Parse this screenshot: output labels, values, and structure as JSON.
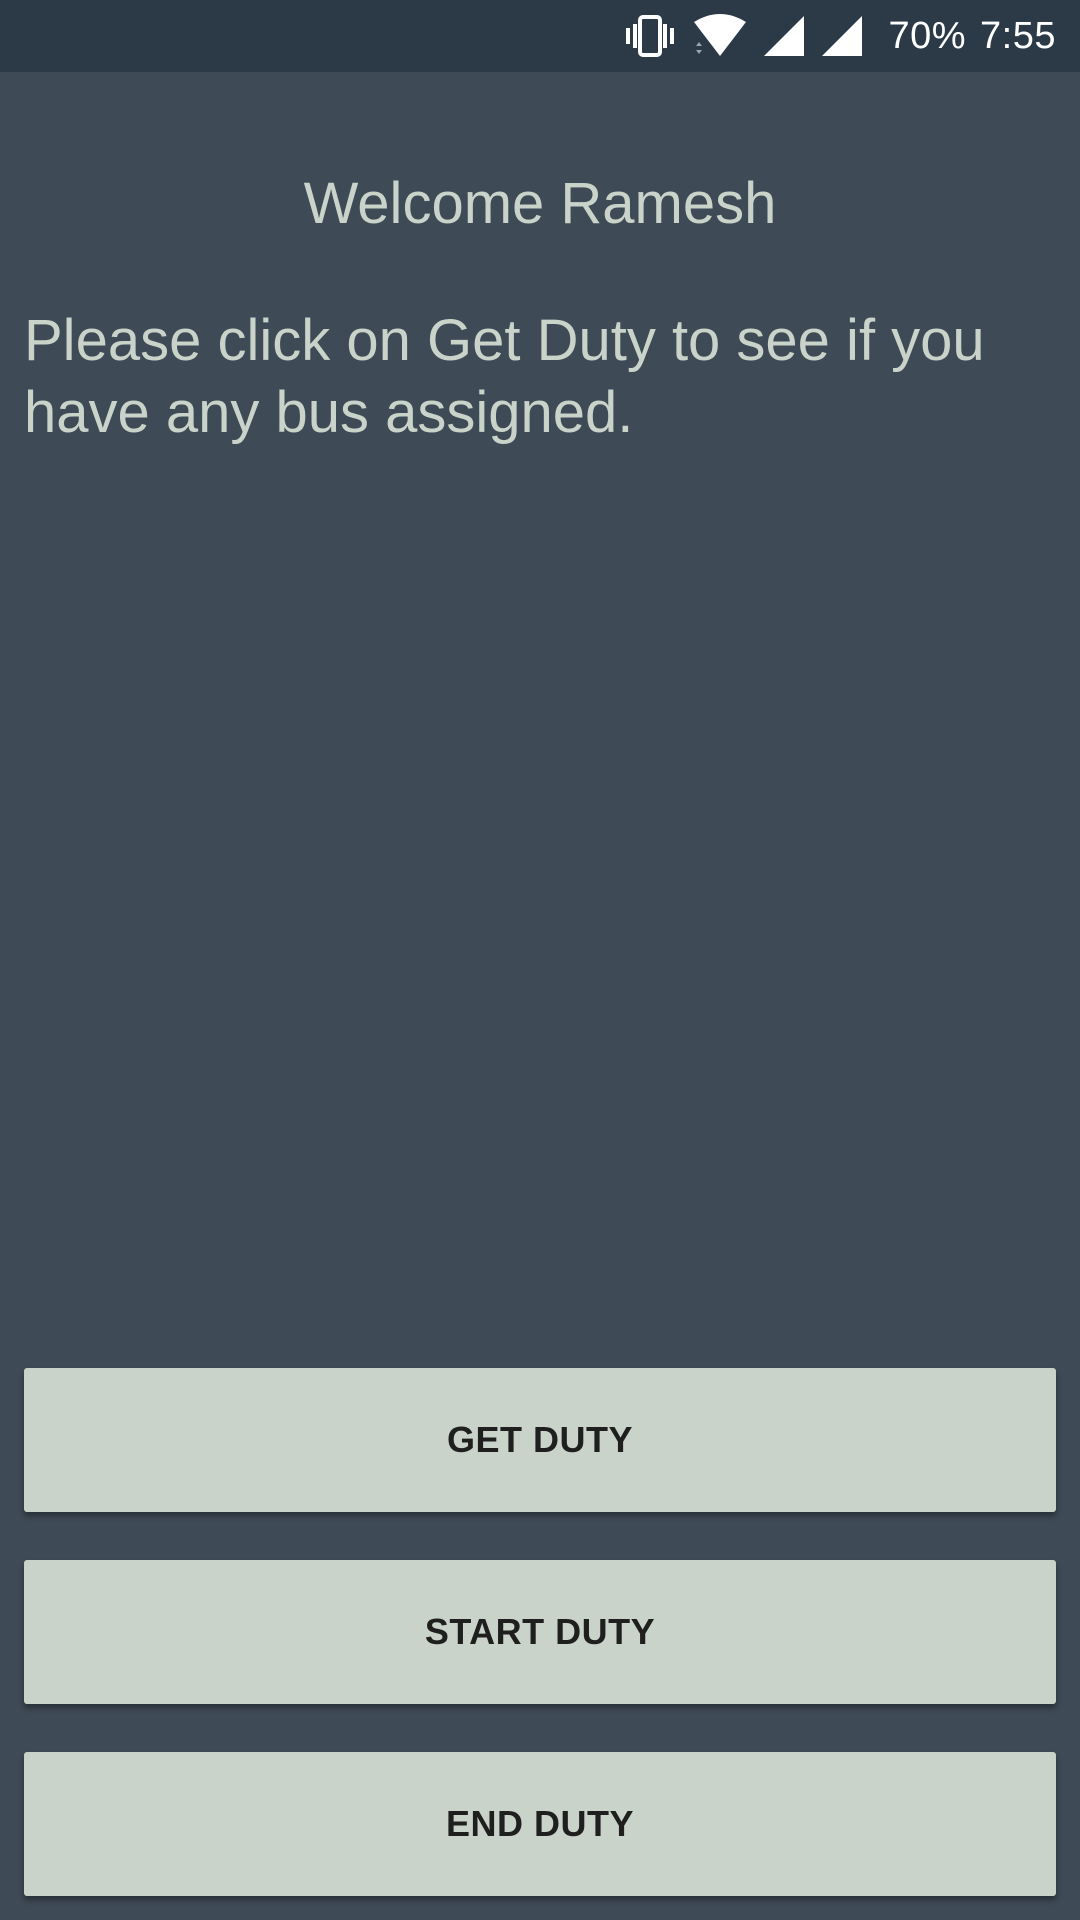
{
  "status_bar": {
    "battery": "70%",
    "time": "7:55",
    "icons": [
      "vibrate-icon",
      "wifi-icon",
      "cell-signal-icon",
      "cell-signal-icon"
    ]
  },
  "main": {
    "welcome": "Welcome Ramesh",
    "message": "Please click on Get Duty to see if you have any bus assigned."
  },
  "buttons": {
    "get_duty": "GET DUTY",
    "start_duty": "START DUTY",
    "end_duty": "END DUTY"
  },
  "colors": {
    "background": "#3e4a56",
    "status_bar": "#2c3a48",
    "button": "#c9d3c9",
    "text": "#c9d3c9"
  }
}
